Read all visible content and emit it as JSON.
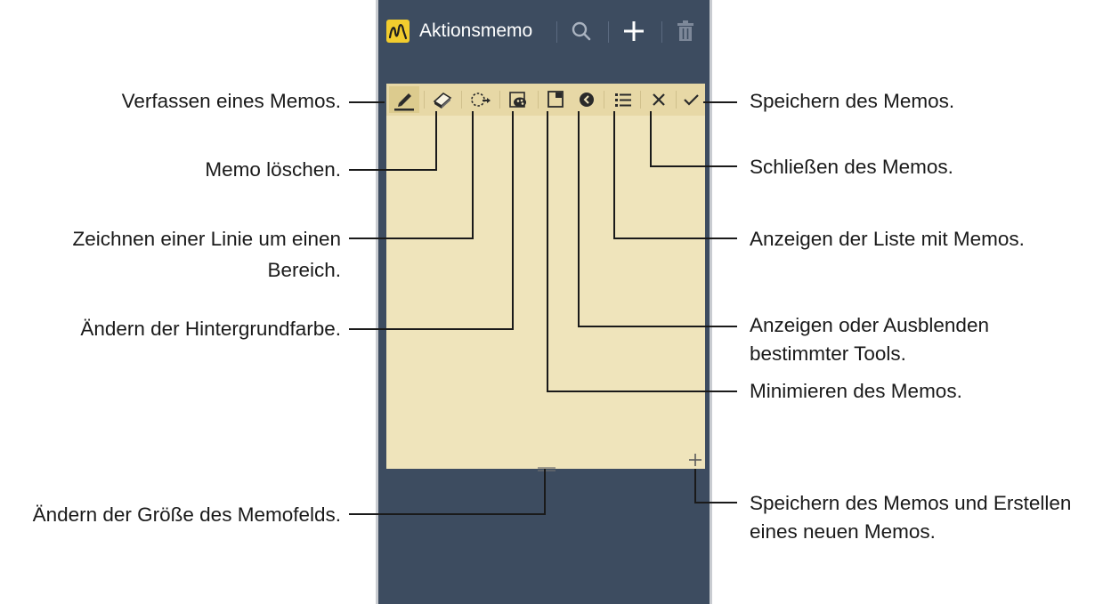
{
  "app": {
    "title": "Aktionsmemo"
  },
  "action_bar_icons": [
    "app-logo-icon",
    "search-icon",
    "plus-icon",
    "trash-icon"
  ],
  "toolbar_icons": [
    "pen-icon",
    "eraser-icon",
    "lasso-icon",
    "palette-icon",
    "minimize-icon",
    "collapse-icon",
    "list-icon",
    "close-icon",
    "check-icon"
  ],
  "colors": {
    "phone_bg": "#3d4c60",
    "memo_bg": "#efe4bb",
    "logo": "#f2cc2e"
  },
  "callouts": {
    "pen": "Verfassen eines Memos.",
    "eraser": "Memo löschen.",
    "lasso_line1": "Zeichnen einer Linie um einen",
    "lasso_line2": "Bereich.",
    "background": "Ändern der Hintergrundfarbe.",
    "resize": "Ändern der Größe des Memofelds.",
    "save": "Speichern des Memos.",
    "close": "Schließen des Memos.",
    "list": "Anzeigen der Liste mit Memos.",
    "tools_line1": "Anzeigen oder Ausblenden",
    "tools_line2": "bestimmter Tools.",
    "minimize": "Minimieren des Memos.",
    "new_line1": "Speichern des Memos und Erstellen",
    "new_line2": "eines neuen Memos."
  }
}
